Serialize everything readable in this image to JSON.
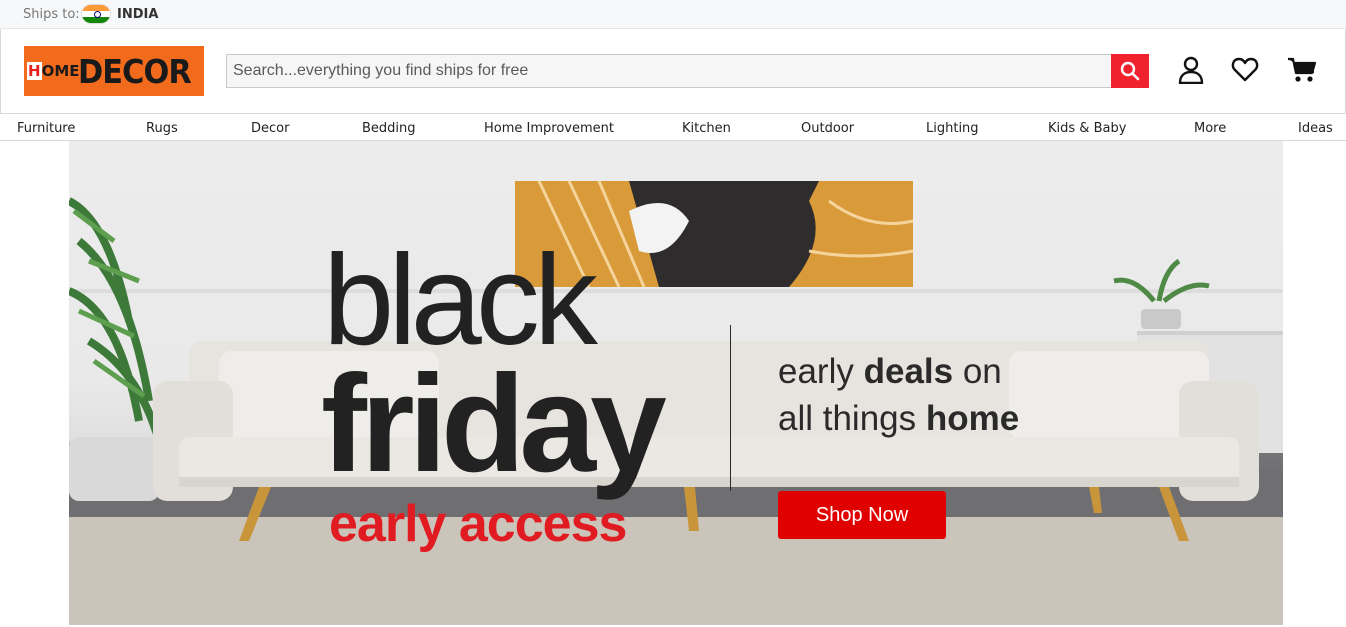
{
  "topbar": {
    "ships_label": "Ships to:",
    "country": "INDIA",
    "flag_icon": "india-flag-icon"
  },
  "header": {
    "logo": {
      "home": "HOME",
      "decor": "DECOR",
      "brand_color": "#f26b1d"
    },
    "search": {
      "placeholder": "Search...everything you find ships for free",
      "value": ""
    },
    "icons": [
      "search-icon",
      "account-icon",
      "heart-icon",
      "cart-icon"
    ],
    "accent_color": "#f0222d"
  },
  "nav": {
    "items": [
      "Furniture",
      "Rugs",
      "Decor",
      "Bedding",
      "Home Improvement",
      "Kitchen",
      "Outdoor",
      "Lighting",
      "Kids & Baby",
      "More",
      "Ideas"
    ]
  },
  "hero": {
    "line1": "black",
    "line2": "friday",
    "line3": "early access",
    "sub1_a": "early ",
    "sub1_b": "deals",
    "sub1_c": " on",
    "sub2_a": "all things ",
    "sub2_b": "home",
    "cta": "Shop Now",
    "cta_color": "#e00000",
    "highlight_color": "#e11b22"
  }
}
